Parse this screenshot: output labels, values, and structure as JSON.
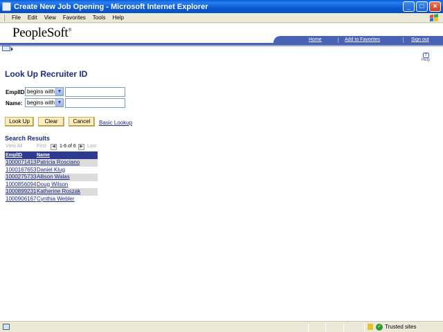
{
  "window": {
    "title": "Create New Job Opening - Microsoft Internet Explorer",
    "minimize": "_",
    "maximize": "□",
    "close": "×"
  },
  "menubar": [
    "File",
    "Edit",
    "View",
    "Favorites",
    "Tools",
    "Help"
  ],
  "header": {
    "logo": "PeopleSoft",
    "logo_mark": "®",
    "links": [
      "Home",
      "Add to Favorites",
      "Sign out"
    ],
    "help": "Help"
  },
  "page": {
    "title": "Look Up Recruiter ID"
  },
  "search": {
    "fields": [
      {
        "label": "EmplID:",
        "operator": "begins with",
        "value": ""
      },
      {
        "label": "Name:",
        "operator": "begins with",
        "value": ""
      }
    ],
    "buttons": {
      "lookup": "Look Up",
      "clear": "Clear",
      "cancel": "Cancel"
    },
    "basic_lookup": "Basic Lookup"
  },
  "results": {
    "title": "Search Results",
    "view_all": "View All",
    "first": "First",
    "last": "Last",
    "counter": "1-6 of 6",
    "columns": [
      "EmplID",
      "Name"
    ],
    "rows": [
      {
        "emplid": "1000071413",
        "name": "Patricia Rosciano"
      },
      {
        "emplid": "1000167653",
        "name": "Daniel Klug"
      },
      {
        "emplid": "1000275733",
        "name": "Allison Walas"
      },
      {
        "emplid": "1000856094",
        "name": "Doug Wilson"
      },
      {
        "emplid": "1000899231",
        "name": "Katherine Roszak"
      },
      {
        "emplid": "1000906167",
        "name": "Cynthia Webler"
      }
    ]
  },
  "statusbar": {
    "zone": "Trusted sites"
  }
}
